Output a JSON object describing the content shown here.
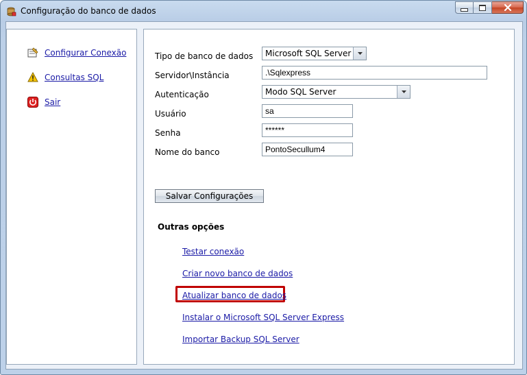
{
  "window": {
    "title": "Configuração do banco de dados",
    "controls": {
      "minimize": "minimize",
      "maximize": "maximize",
      "close": "close"
    }
  },
  "sidebar": {
    "items": [
      {
        "label": "Configurar Conexão",
        "icon": "settings-icon"
      },
      {
        "label": "Consultas SQL",
        "icon": "warning-icon"
      },
      {
        "label": "Sair",
        "icon": "power-icon"
      }
    ]
  },
  "form": {
    "db_type": {
      "label": "Tipo de banco de dados",
      "value": "Microsoft SQL Server"
    },
    "server": {
      "label": "Servidor\\Instância",
      "value": ".\\Sqlexpress"
    },
    "auth": {
      "label": "Autenticação",
      "value": "Modo SQL Server"
    },
    "user": {
      "label": "Usuário",
      "value": "sa"
    },
    "password": {
      "label": "Senha",
      "value": "******"
    },
    "db_name": {
      "label": "Nome do banco",
      "value": "PontoSecullum4"
    },
    "save_label": "Salvar Configurações"
  },
  "other_options": {
    "title": "Outras opções",
    "links": [
      "Testar conexão",
      "Criar novo banco de dados",
      "Atualizar banco de dados",
      "Instalar o Microsoft SQL Server Express",
      "Importar Backup SQL Server"
    ]
  },
  "colors": {
    "highlight": "#c00000",
    "link": "#1a1aa6"
  }
}
